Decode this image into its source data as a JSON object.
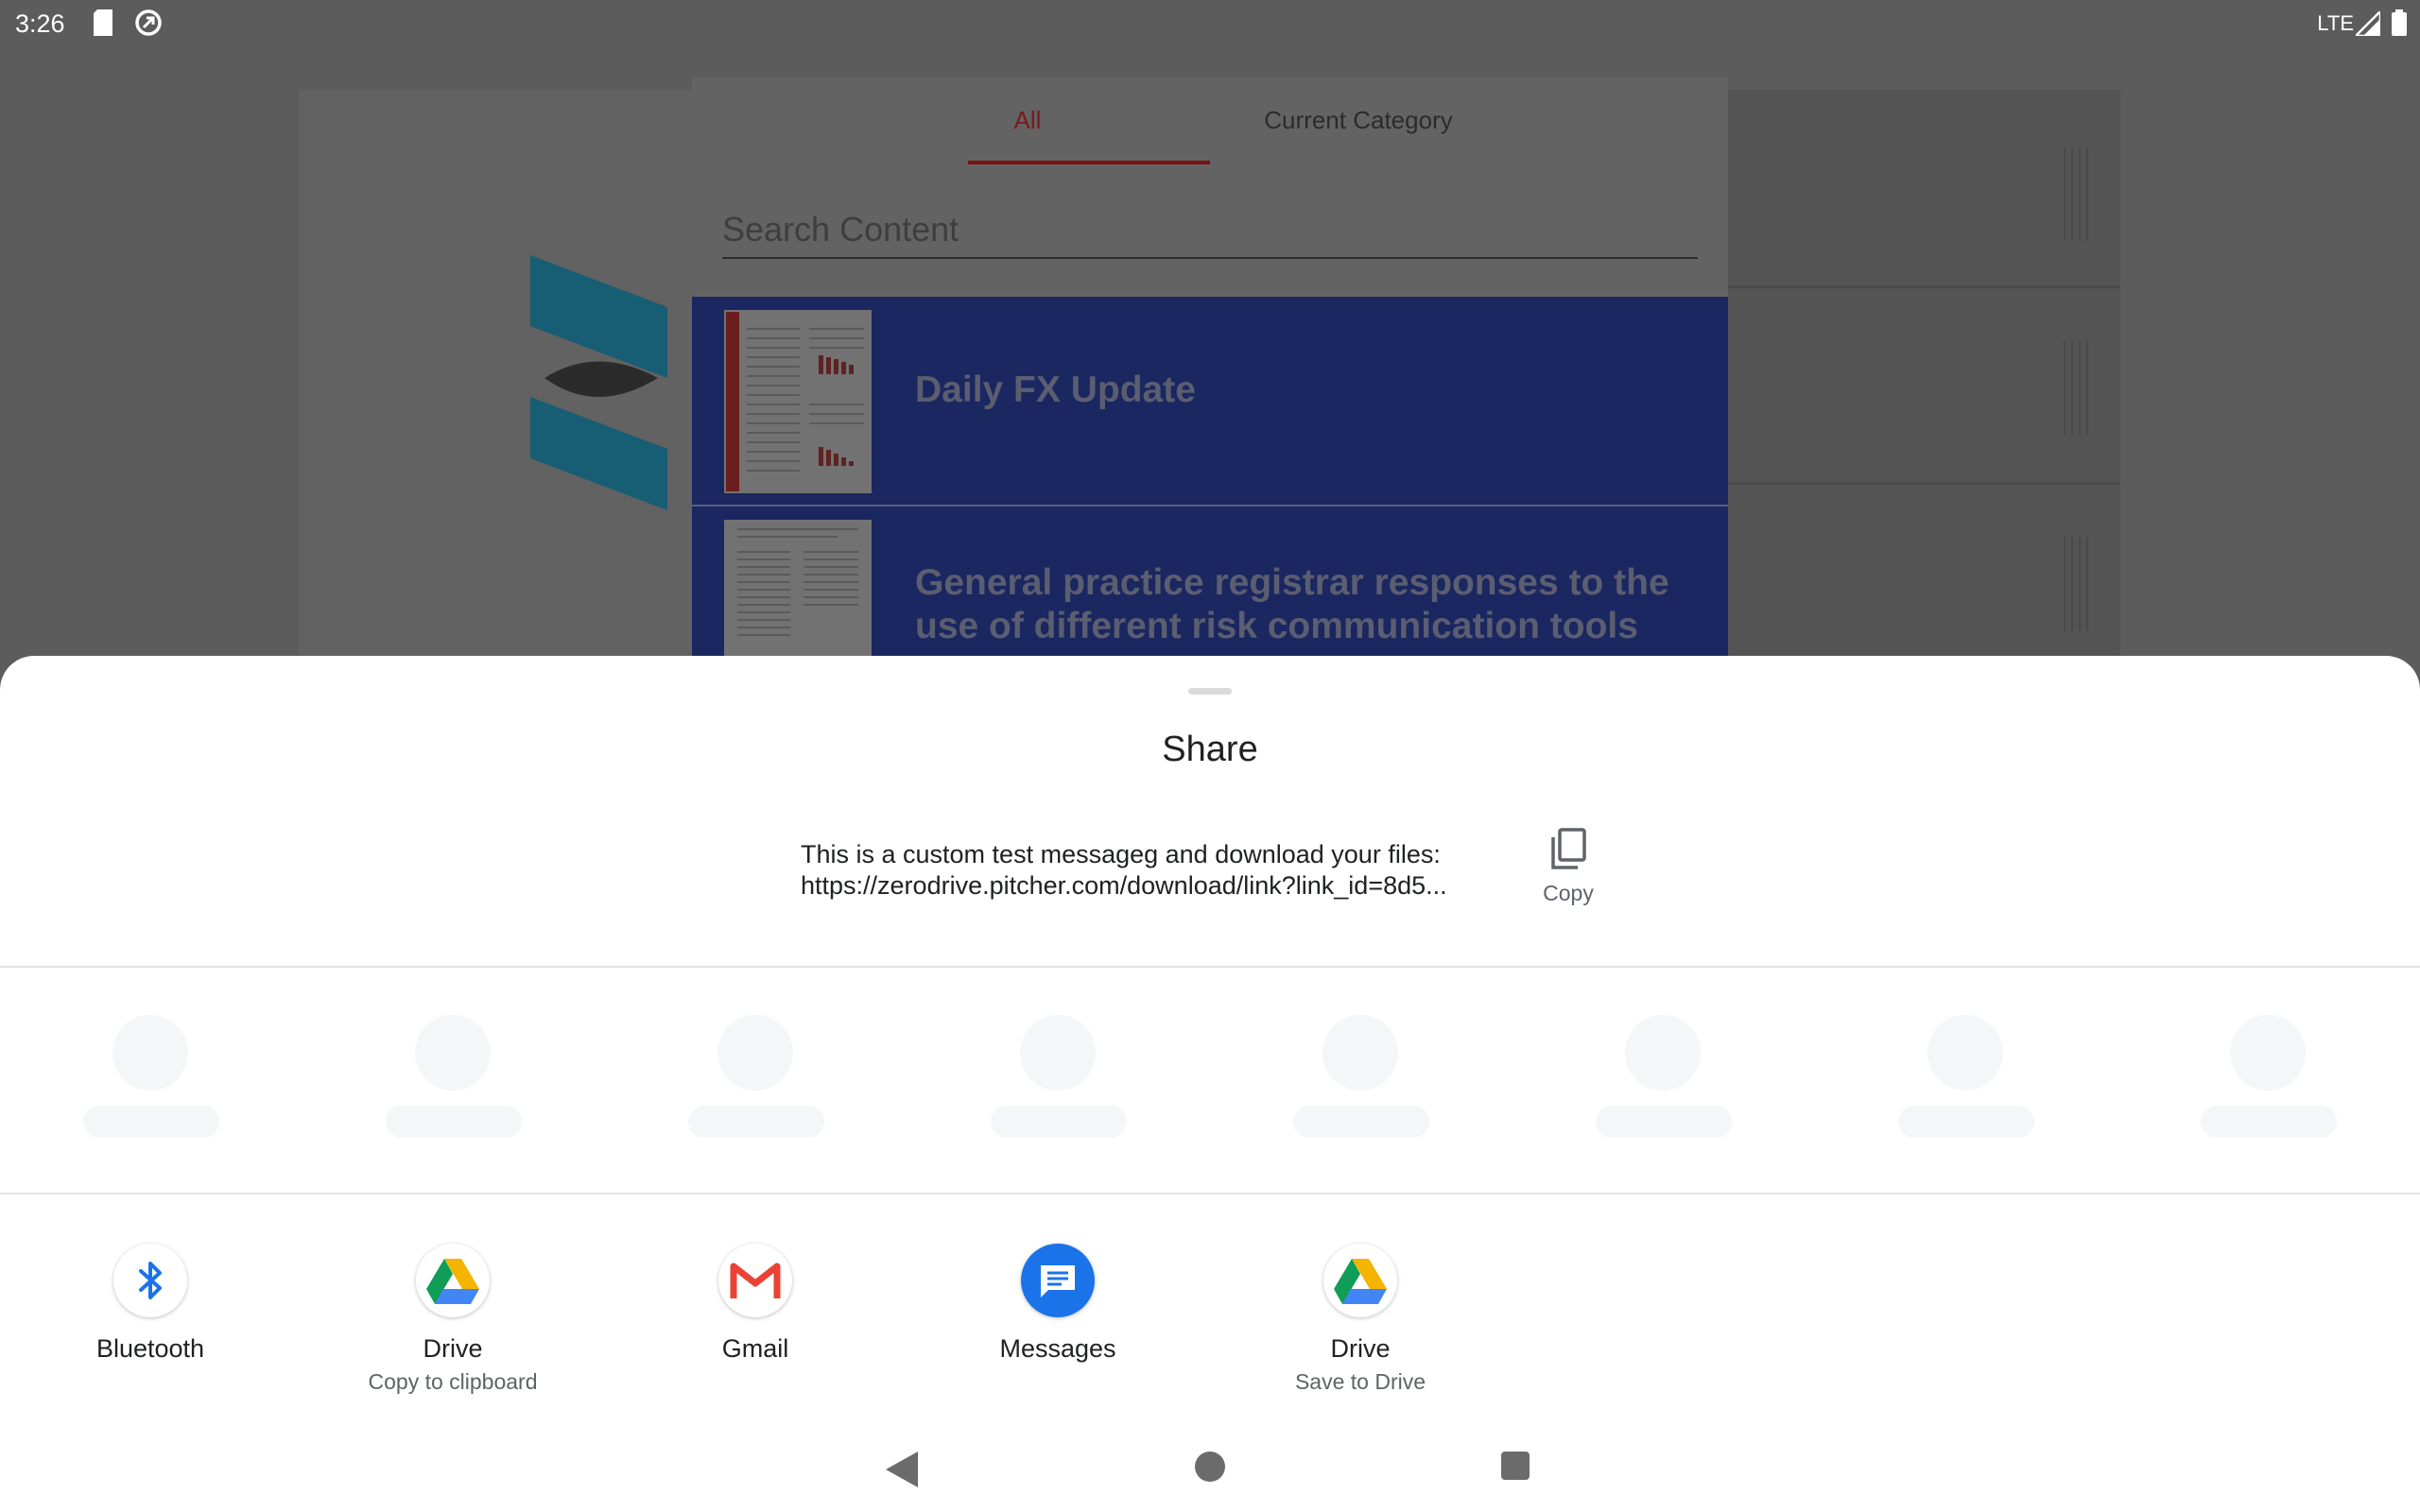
{
  "status_bar": {
    "time": "3:26",
    "network": "LTE"
  },
  "background": {
    "tabs": [
      {
        "label": "All"
      },
      {
        "label": "Current Category"
      }
    ],
    "search_placeholder": "Search Content",
    "items": [
      {
        "title_lines": [
          "Daily FX Update"
        ]
      },
      {
        "title_lines": [
          "General practice registrar responses to the",
          "use of different risk communication tools"
        ]
      }
    ]
  },
  "share_sheet": {
    "title": "Share",
    "message_line1": "This is a custom test messageg and download your files:",
    "message_line2": "https://zerodrive.pitcher.com/download/link?link_id=8d5...",
    "copy_label": "Copy",
    "apps": [
      {
        "name": "Bluetooth",
        "subtitle": "",
        "icon": "bluetooth-icon"
      },
      {
        "name": "Drive",
        "subtitle": "Copy to clipboard",
        "icon": "drive-icon"
      },
      {
        "name": "Gmail",
        "subtitle": "",
        "icon": "gmail-icon"
      },
      {
        "name": "Messages",
        "subtitle": "",
        "icon": "messages-icon"
      },
      {
        "name": "Drive",
        "subtitle": "Save to Drive",
        "icon": "drive-icon"
      }
    ]
  },
  "colors": {
    "bluetooth": "#1a73e8",
    "messages": "#1a73e8",
    "drive_green": "#0f9d58",
    "drive_yellow": "#f4b400",
    "drive_blue": "#4285f4",
    "gmail_red": "#ea4335"
  }
}
